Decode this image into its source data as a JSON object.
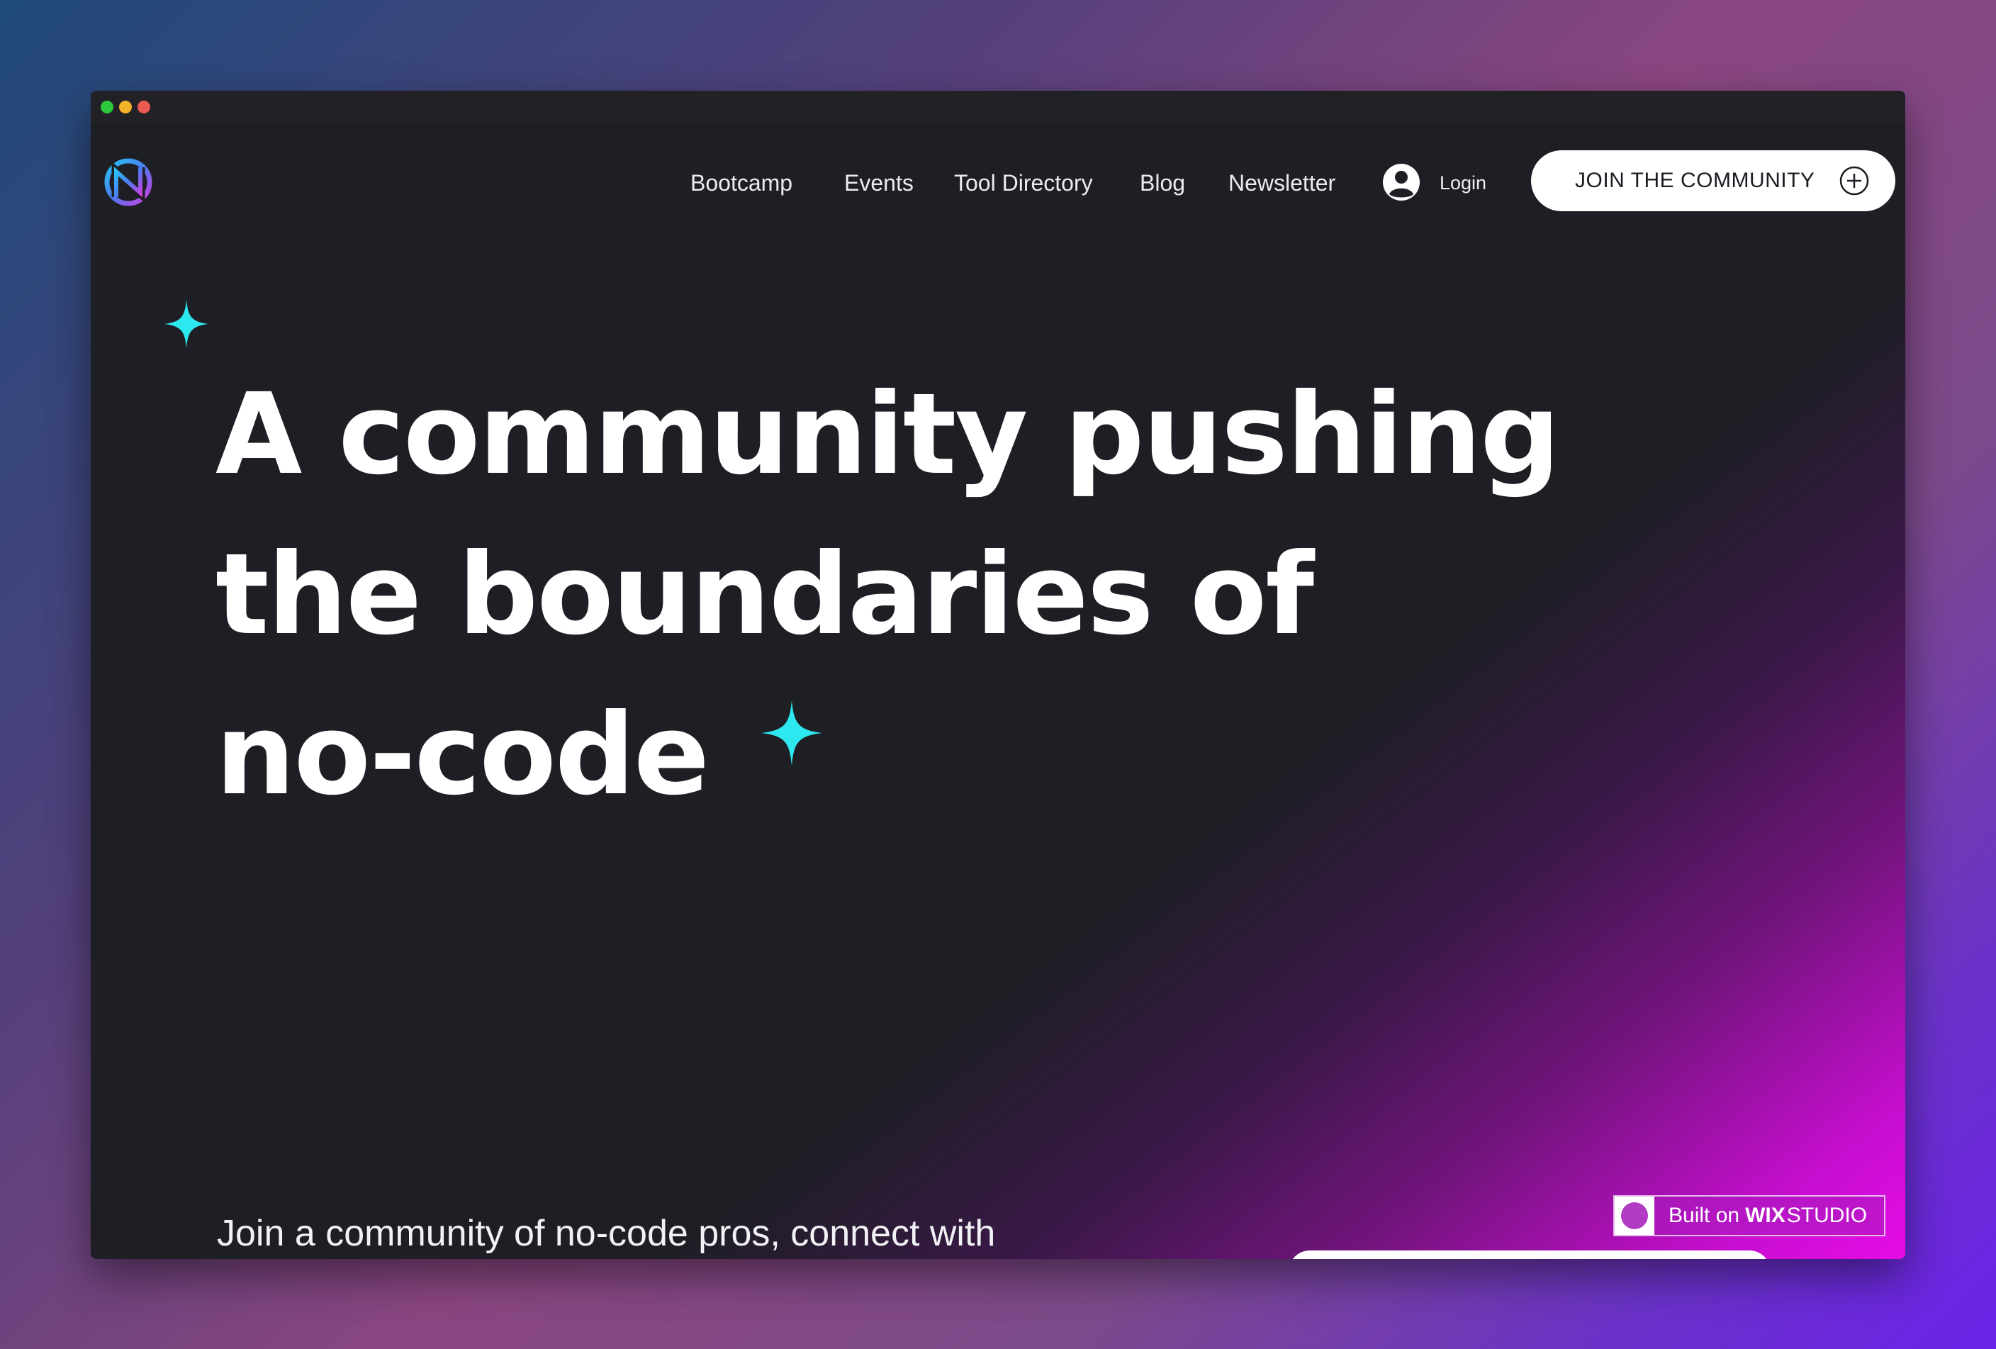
{
  "browser": {
    "buttons": [
      "close",
      "minimize",
      "maximize"
    ]
  },
  "header": {
    "logo_icon": "brand-logo-icon",
    "nav": [
      {
        "label": "Bootcamp"
      },
      {
        "label": "Events"
      },
      {
        "label": "Tool Directory"
      },
      {
        "label": "Blog"
      },
      {
        "label": "Newsletter"
      }
    ],
    "login_label": "Login",
    "login_icon": "user-avatar-icon",
    "join_label": "JOIN THE COMMUNITY",
    "join_icon": "plus-circle-icon"
  },
  "hero": {
    "headline_line1": "A community pushing",
    "headline_line2": "the boundaries of",
    "headline_line3": "no-code",
    "sparkle_icon": "sparkle-icon",
    "subtext": "Join a community of no-code pros, connect with"
  },
  "badge": {
    "prefix": "Built on",
    "brand": "WIX",
    "suffix": "STUDIO"
  },
  "colors": {
    "page_bg": "#1e1e25",
    "accent_cyan": "#2ee8f0",
    "accent_magenta": "#e60ce6",
    "button_bg": "#ffffff"
  }
}
